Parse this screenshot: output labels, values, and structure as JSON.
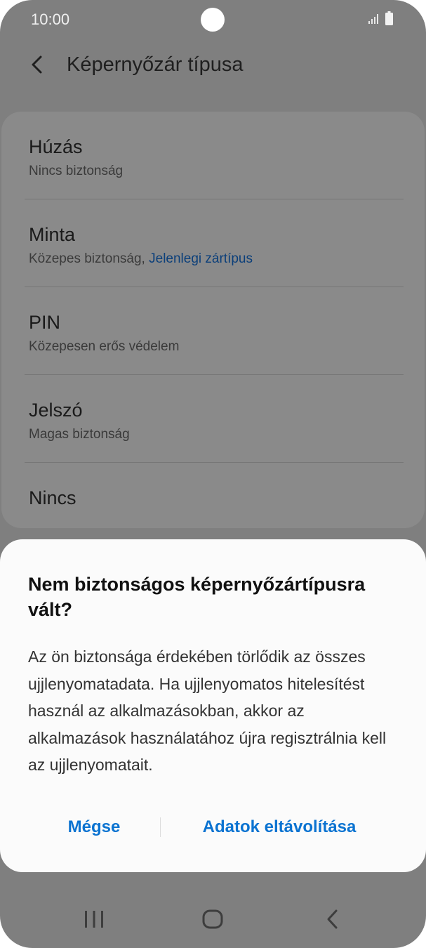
{
  "status_bar": {
    "time": "10:00"
  },
  "header": {
    "title": "Képernyőzár típusa"
  },
  "options": [
    {
      "title": "Húzás",
      "subtitle": "Nincs biztonság"
    },
    {
      "title": "Minta",
      "subtitle": "Közepes biztonság, ",
      "subtitle_current": "Jelenlegi zártípus"
    },
    {
      "title": "PIN",
      "subtitle": "Közepesen erős védelem"
    },
    {
      "title": "Jelszó",
      "subtitle": "Magas biztonság"
    },
    {
      "title": "Nincs"
    }
  ],
  "dialog": {
    "title": "Nem biztonságos képernyőzártípusra vált?",
    "body": "Az ön biztonsága érdekében törlődik az összes ujjlenyomatadata. Ha ujjlenyomatos hitelesítést használ az alkalmazásokban, akkor az alkalmazások használatához újra regisztrálnia kell az ujjlenyomatait.",
    "cancel_label": "Mégse",
    "confirm_label": "Adatok eltávolítása"
  },
  "colors": {
    "scrim": "#7f7f7f",
    "accent": "#0b73d1",
    "current_type": "#0b3f7a",
    "dialog_bg": "#fbfbfb"
  },
  "icons": {
    "back": "chevron-left-icon",
    "recents": "recent-apps-icon",
    "home": "home-icon",
    "nav_back": "back-icon"
  }
}
